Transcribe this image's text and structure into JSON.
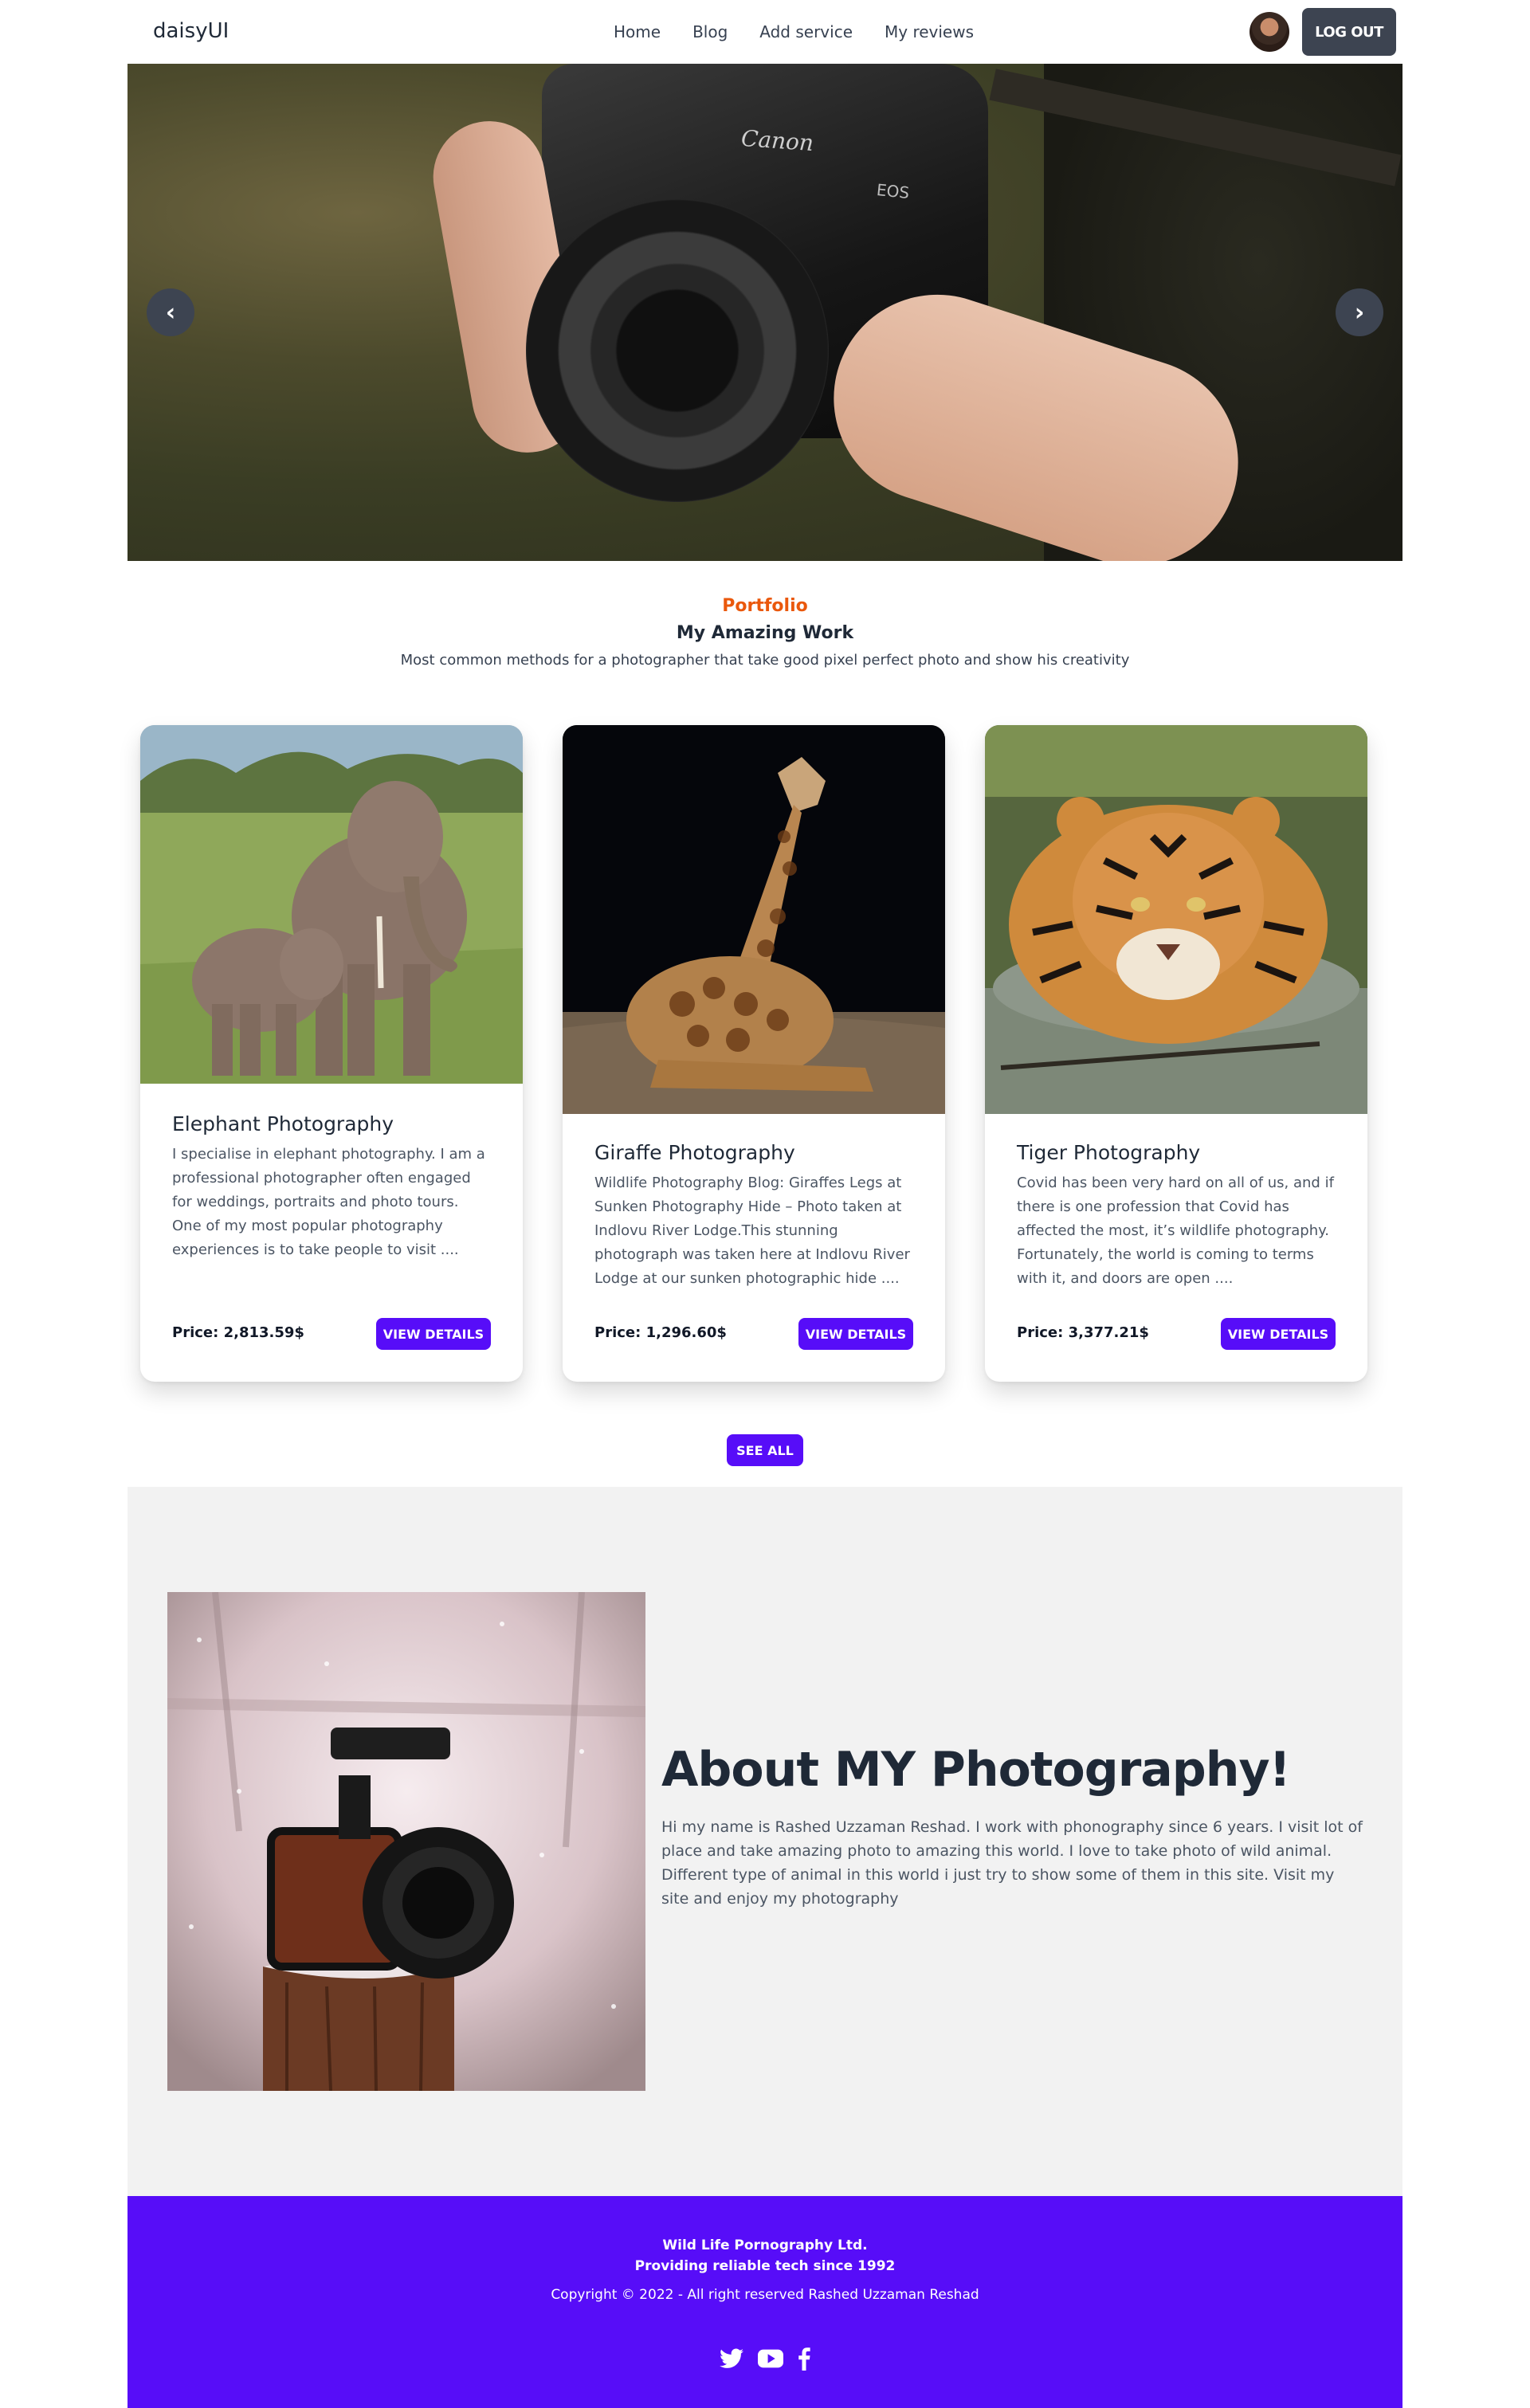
{
  "nav": {
    "brand": "daisyUI",
    "links": [
      "Home",
      "Blog",
      "Add service",
      "My reviews"
    ],
    "logout_label": "LOG OUT"
  },
  "hero": {
    "prev_label": "‹",
    "next_label": "›",
    "camera_brand": "Canon",
    "camera_model": "EOS"
  },
  "portfolio": {
    "tag": "Portfolio",
    "title": "My Amazing Work",
    "description": "Most common methods for a photographer that take good pixel perfect photo and show his creativity"
  },
  "cards": [
    {
      "title": "Elephant Photography",
      "description": "I specialise in elephant photography. I am a professional photographer often engaged for weddings, portraits and photo tours. One of my most popular photography experiences is to take people to visit ....",
      "price": "Price: 2,813.59$",
      "button": "VIEW DETAILS"
    },
    {
      "title": "Giraffe Photography",
      "description": "Wildlife Photography Blog: Giraffes Legs at Sunken Photography Hide – Photo taken at Indlovu River Lodge.This stunning photograph was taken here at Indlovu River Lodge at our sunken photographic hide ....",
      "price": "Price: 1,296.60$",
      "button": "VIEW DETAILS"
    },
    {
      "title": "Tiger Photography",
      "description": "Covid has been very hard on all of us, and if there is one profession that Covid has affected the most, it’s wildlife photography. Fortunately, the world is coming to terms with it, and doors are open ....",
      "price": "Price: 3,377.21$",
      "button": "VIEW DETAILS"
    }
  ],
  "see_all_label": "SEE ALL",
  "about": {
    "title": "About MY Photography!",
    "text": "Hi my name is Rashed Uzzaman Reshad. I work with phonography since 6 years. I visit lot of place and take amazing photo to amazing this world. I love to take photo of wild animal. Different type of animal in this world i just try to show some of them in this site. Visit my site and enjoy my photography"
  },
  "footer": {
    "company": "Wild Life Pornography Ltd.",
    "tagline": "Providing reliable tech since 1992",
    "copyright": "Copyright © 2022 - All right reserved Rashed Uzzaman Reshad",
    "social": [
      "twitter-icon",
      "youtube-icon",
      "facebook-icon"
    ]
  },
  "colors": {
    "primary": "#570df8",
    "accent_orange": "#ea580c",
    "neutral": "#3d4451",
    "about_bg": "#f2f2f2"
  }
}
